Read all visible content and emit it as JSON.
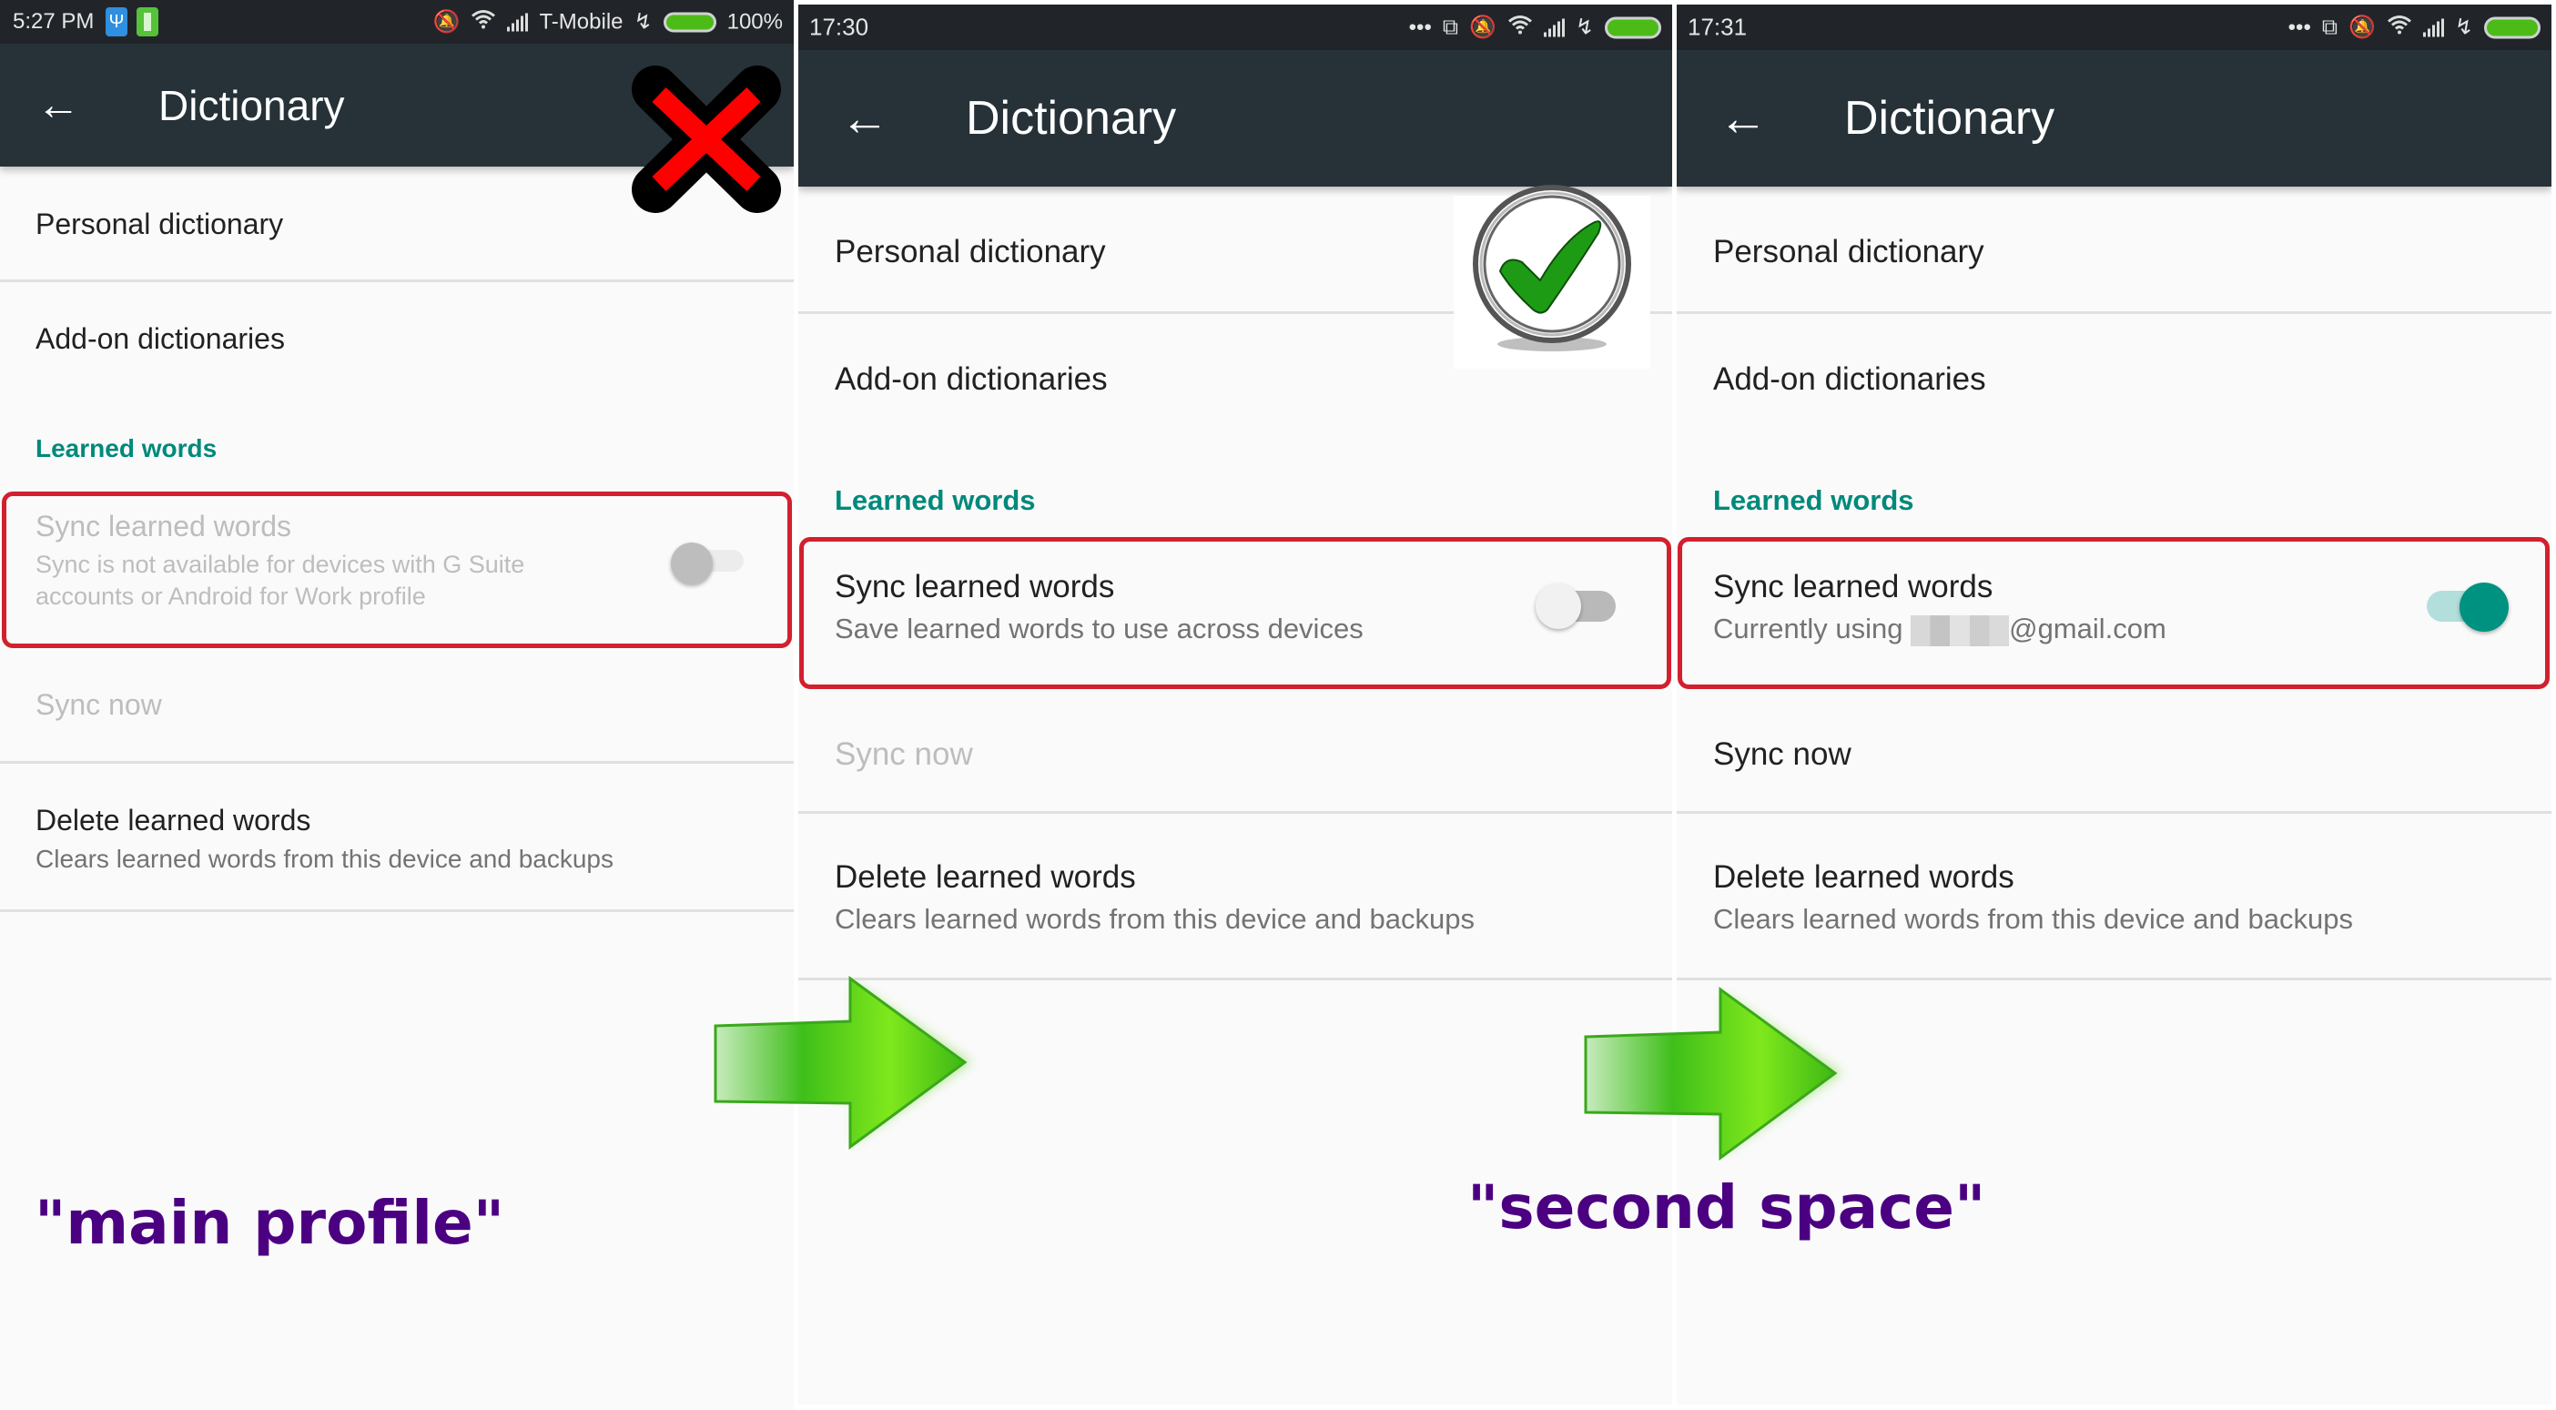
{
  "panels": [
    {
      "status_bar": {
        "time": "5:27 PM",
        "carrier": "T-Mobile",
        "battery_percent": "100%",
        "icons": [
          "usb-icon",
          "battery-saver-icon",
          "mute-icon",
          "wifi-icon",
          "signal-icon",
          "charging-icon",
          "battery-icon"
        ]
      },
      "app_bar": {
        "title": "Dictionary",
        "back_icon": "arrow-left"
      },
      "items": {
        "personal_dictionary": "Personal dictionary",
        "addon_dictionaries": "Add-on dictionaries",
        "section_header": "Learned words",
        "sync_title": "Sync learned words",
        "sync_subtitle_line1": "Sync is not available for devices with G Suite",
        "sync_subtitle_line2": "accounts or Android for Work profile",
        "sync_toggle": {
          "state": "off",
          "enabled": false
        },
        "sync_now": "Sync now",
        "sync_now_enabled": false,
        "delete_title": "Delete learned words",
        "delete_subtitle": "Clears learned words from this device and backups"
      },
      "overlay": "red-x-mark",
      "annotation": "\"main profile\""
    },
    {
      "status_bar": {
        "time": "17:30",
        "icons": [
          "more-dots-icon",
          "rotate-icon",
          "mute-icon",
          "wifi-icon",
          "signal-icon",
          "charging-icon",
          "battery-icon"
        ]
      },
      "app_bar": {
        "title": "Dictionary",
        "back_icon": "arrow-left"
      },
      "items": {
        "personal_dictionary": "Personal dictionary",
        "addon_dictionaries": "Add-on dictionaries",
        "section_header": "Learned words",
        "sync_title": "Sync learned words",
        "sync_subtitle": "Save learned words to use across devices",
        "sync_toggle": {
          "state": "off",
          "enabled": true
        },
        "sync_now": "Sync now",
        "sync_now_enabled": false,
        "delete_title": "Delete learned words",
        "delete_subtitle": "Clears learned words from this device and backups"
      },
      "overlay": "green-checkmark"
    },
    {
      "status_bar": {
        "time": "17:31",
        "icons": [
          "more-dots-icon",
          "rotate-icon",
          "mute-icon",
          "wifi-icon",
          "signal-icon",
          "charging-icon",
          "battery-icon"
        ]
      },
      "app_bar": {
        "title": "Dictionary",
        "back_icon": "arrow-left"
      },
      "items": {
        "personal_dictionary": "Personal dictionary",
        "addon_dictionaries": "Add-on dictionaries",
        "section_header": "Learned words",
        "sync_title": "Sync learned words",
        "sync_subtitle_prefix": "Currently using ",
        "sync_subtitle_email_suffix": "@gmail.com",
        "sync_toggle": {
          "state": "on",
          "enabled": true
        },
        "sync_now": "Sync now",
        "sync_now_enabled": true,
        "delete_title": "Delete learned words",
        "delete_subtitle": "Clears learned words from this device and backups"
      }
    }
  ],
  "annotations": {
    "main_profile": "\"main profile\"",
    "second_space": "\"second space\""
  },
  "colors": {
    "app_bar": "#263238",
    "status_bar": "#212529",
    "accent": "#00897b",
    "highlight_box": "#d2202e",
    "annotation_text": "#4b0082",
    "arrow": "#4fd11a",
    "battery": "#4cbb17"
  }
}
